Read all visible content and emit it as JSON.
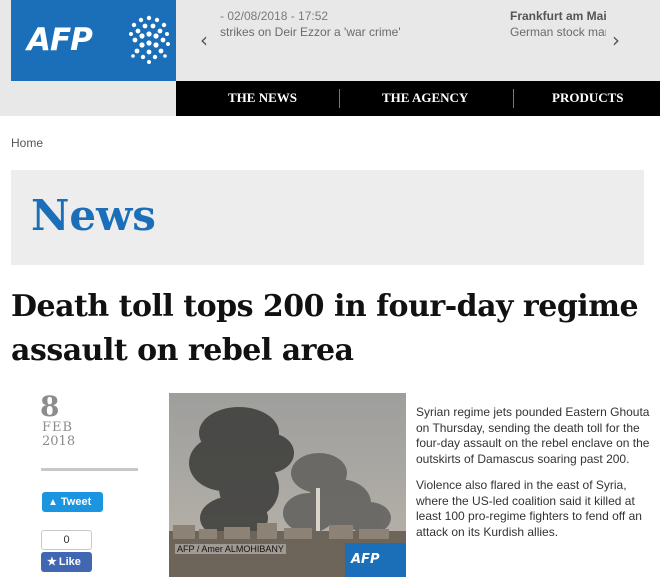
{
  "brand": {
    "logo_text": "AFP"
  },
  "ticker": {
    "items": [
      {
        "date": "- 02/08/2018 - 17:52",
        "text": "strikes on Deir Ezzor a 'war crime'"
      },
      {
        "date": "Frankfurt am Mai",
        "text": "German stock mar"
      }
    ],
    "prev_glyph": "‹",
    "next_glyph": "›"
  },
  "nav": {
    "items": [
      "THE NEWS",
      "THE AGENCY",
      "PRODUCTS"
    ]
  },
  "breadcrumb": {
    "home": "Home"
  },
  "section": {
    "title": "News"
  },
  "article": {
    "headline": "Death toll tops 200 in four-day regime assault on rebel area",
    "date": {
      "day": "8",
      "month": "FEB",
      "year": "2018"
    },
    "photo_credit": "AFP / Amer ALMOHIBANY",
    "photo_logo": "AFP",
    "paragraphs": [
      "Syrian regime jets pounded Eastern Ghouta on Thursday, sending the death toll for the four-day assault on the rebel enclave on the outskirts of Damascus soaring past 200.",
      "Violence also flared in the east of Syria, where the US-led coalition said it killed at least 100 pro-regime fighters to fend off an attack on its Kurdish allies."
    ]
  },
  "share": {
    "tweet_label": "Tweet",
    "like_count": "0",
    "like_label": "Like"
  },
  "colors": {
    "brand_blue": "#1b6fb8",
    "nav_bg": "#000000",
    "twitter_blue": "#1b95e0",
    "facebook_blue": "#4267b2"
  },
  "icons": [
    "afp-globe-icon",
    "chevron-left-icon",
    "chevron-right-icon",
    "twitter-bird-icon",
    "thumbs-up-icon"
  ]
}
